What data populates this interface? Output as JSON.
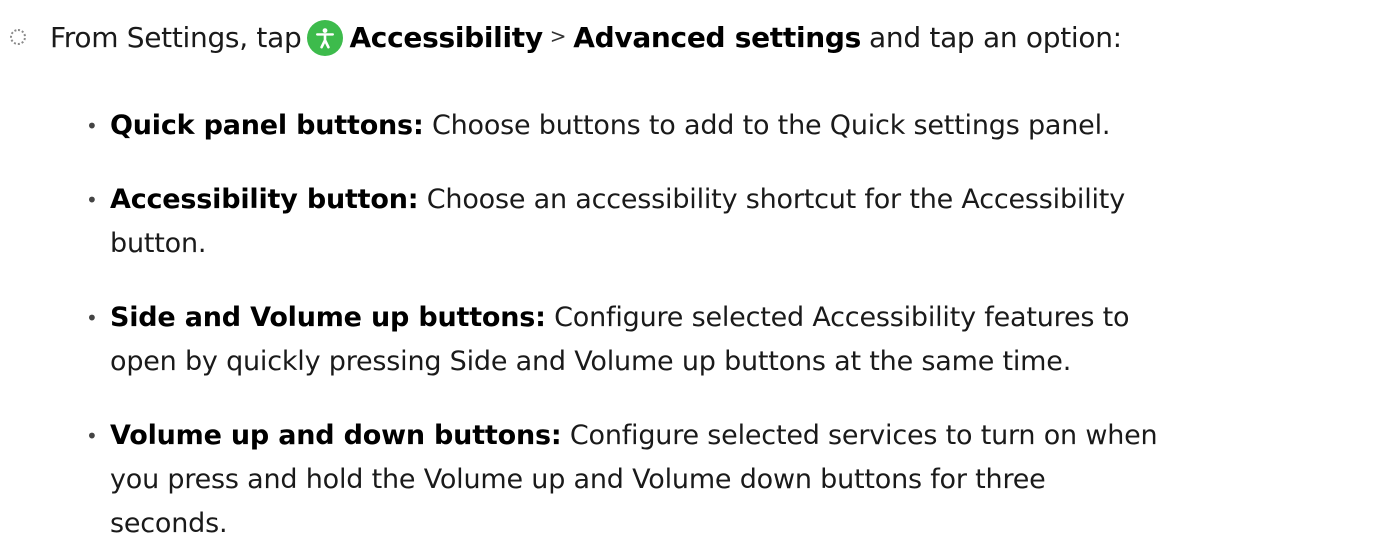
{
  "step": {
    "prefix": "From Settings, tap",
    "icon": "accessibility-icon",
    "icon_color": "#3DBB4C",
    "menu_1": "Accessibility",
    "separator": ">",
    "menu_2": "Advanced settings",
    "suffix": "and tap an option:"
  },
  "options": [
    {
      "title": "Quick panel buttons",
      "colon": ":",
      "lines": [
        "Choose buttons to add to the Quick settings panel."
      ]
    },
    {
      "title": "Accessibility button",
      "colon": ":",
      "lines": [
        "Choose an accessibility shortcut for the Accessibility",
        "button."
      ]
    },
    {
      "title": "Side and Volume up buttons",
      "colon": ":",
      "lines": [
        "Configure selected Accessibility features to",
        "open by quickly pressing Side and Volume up buttons at the same time."
      ]
    },
    {
      "title": "Volume up and down buttons",
      "colon": ":",
      "lines": [
        "Configure selected services to turn on when",
        "you press and hold the Volume up and Volume down buttons for three",
        "seconds."
      ]
    }
  ]
}
